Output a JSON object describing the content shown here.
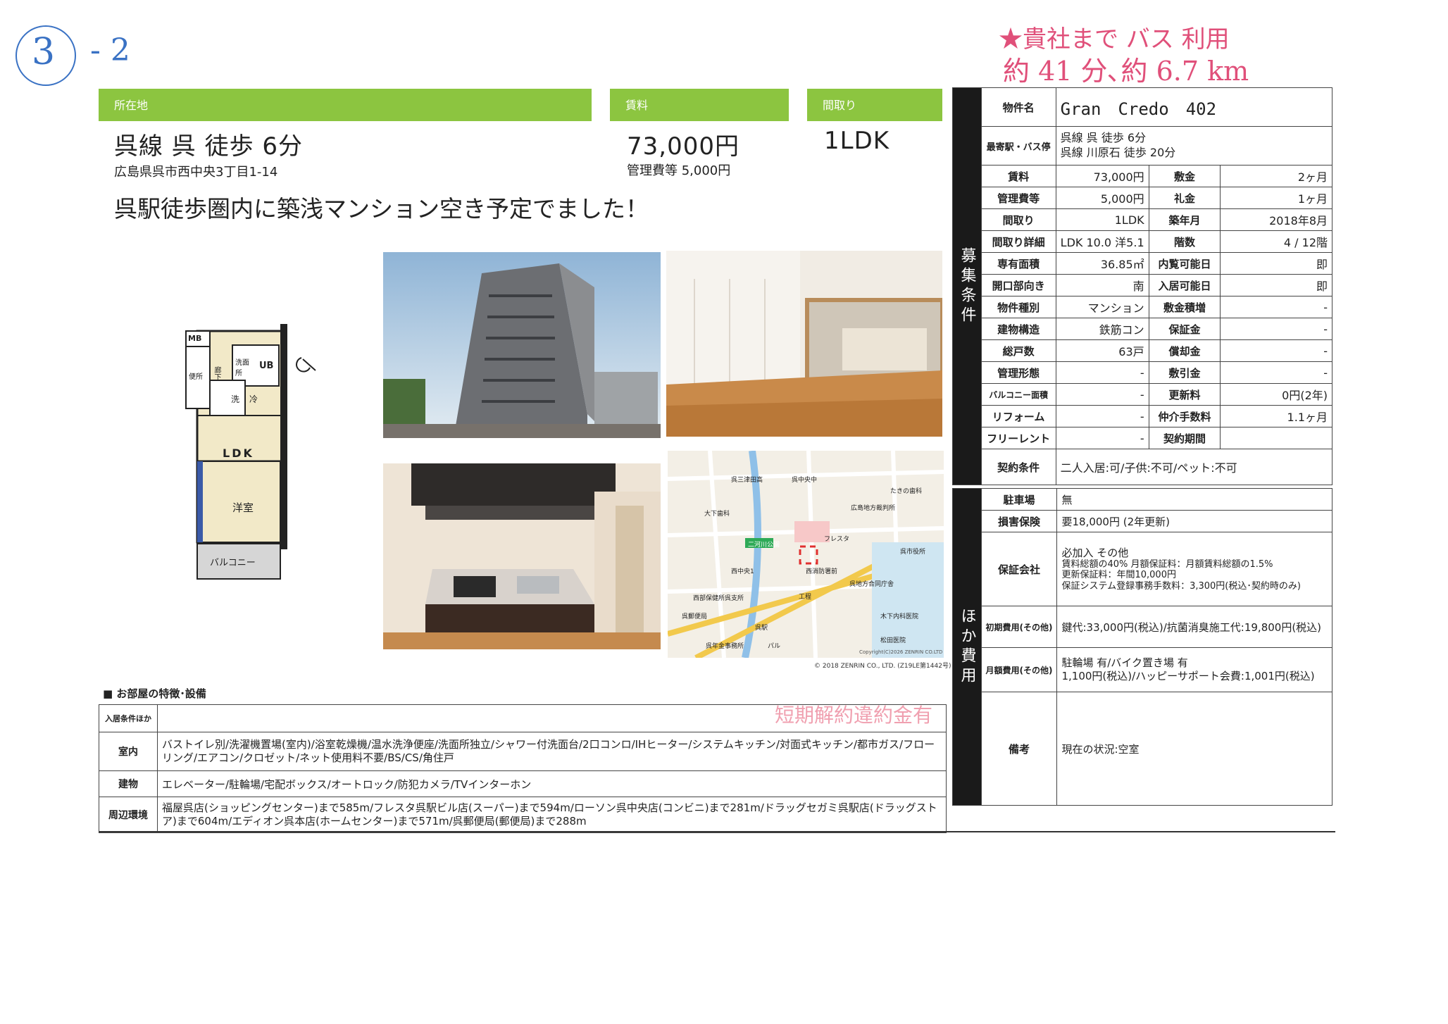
{
  "handwritten": {
    "circle_number": "3",
    "suffix": "- 2",
    "note_line1": "★貴社まで バス 利用",
    "note_line2": "約 41 分､約 6.7 km"
  },
  "header": {
    "location_label": "所在地",
    "rent_label": "賃料",
    "layout_label": "間取り"
  },
  "summary": {
    "station": "呉線 呉 徒歩 6分",
    "address": "広島県呉市西中央3丁目1-14",
    "rent": "73,000円",
    "management_fee": "管理費等 5,000円",
    "layout": "1LDK",
    "headline": "呉駅徒歩圏内に築浅マンション空き予定でました！"
  },
  "floorplan": {
    "mb": "MB",
    "toilet": "便所",
    "corridor": "廊下",
    "washroom": "洗面所",
    "ub": "UB",
    "wash": "洗",
    "fridge": "冷",
    "ldk": "LDK",
    "western_room": "洋室",
    "balcony": "バルコニー"
  },
  "map": {
    "labels": [
      "呉三津田高",
      "呉中央中",
      "たきの歯科",
      "大下歯科",
      "広島地方裁判所",
      "二河川公園",
      "フレスタ",
      "呉市役所",
      "西中央1",
      "西消防署前",
      "呉地方合同庁舎",
      "西部保健所呉支所",
      "工程",
      "木下内科医院",
      "呉郵便局",
      "呉年金事務所",
      "松田医院",
      "パル",
      "呉駅"
    ],
    "copyright1": "Copyright(C)2026 ZENRIN CO.LTD",
    "copyright2": "© 2018 ZENRIN CO., LTD. (Z19LE第1442号)"
  },
  "spec": {
    "band_recruit": "募集条件",
    "band_other": "ほか費用",
    "property_name_label": "物件名",
    "property_name": "Gran　Credo　402",
    "nearest_label": "最寄駅・バス停",
    "nearest1": "呉線 呉 徒歩 6分",
    "nearest2": "呉線 川原石 徒歩 20分",
    "rows": [
      {
        "l1": "賃料",
        "v1": "73,000円",
        "l2": "敷金",
        "v2": "2ヶ月"
      },
      {
        "l1": "管理費等",
        "v1": "5,000円",
        "l2": "礼金",
        "v2": "1ヶ月"
      },
      {
        "l1": "間取り",
        "v1": "1LDK",
        "l2": "築年月",
        "v2": "2018年8月"
      },
      {
        "l1": "間取り詳細",
        "v1": "LDK 10.0 洋5.1",
        "l2": "階数",
        "v2": "4 / 12階"
      },
      {
        "l1": "専有面積",
        "v1": "36.85㎡",
        "l2": "内覧可能日",
        "v2": "即"
      },
      {
        "l1": "開口部向き",
        "v1": "南",
        "l2": "入居可能日",
        "v2": "即"
      },
      {
        "l1": "物件種別",
        "v1": "マンション",
        "l2": "敷金積増",
        "v2": "-"
      },
      {
        "l1": "建物構造",
        "v1": "鉄筋コン",
        "l2": "保証金",
        "v2": "-"
      },
      {
        "l1": "総戸数",
        "v1": "63戸",
        "l2": "償却金",
        "v2": "-"
      },
      {
        "l1": "管理形態",
        "v1": "-",
        "l2": "敷引金",
        "v2": "-"
      },
      {
        "l1": "バルコニー面積",
        "v1": "-",
        "l2": "更新料",
        "v2": "0円(2年)"
      },
      {
        "l1": "リフォーム",
        "v1": "-",
        "l2": "仲介手数料",
        "v2": "1.1ヶ月"
      },
      {
        "l1": "フリーレント",
        "v1": "-",
        "l2": "契約期間",
        "v2": ""
      }
    ],
    "contract_label": "契約条件",
    "contract": "二人入居:可/子供:不可/ペット:不可",
    "parking_label": "駐車場",
    "parking": "無",
    "insurance_label": "損害保険",
    "insurance": "要18,000円 (2年更新)",
    "guarantor_label": "保証会社",
    "guarantor1": "必加入 その他",
    "guarantor2": "賃料総額の40% 月額保証料：月額賃料総額の1.5%",
    "guarantor3": "更新保証料：年間10,000円",
    "guarantor4": "保証システム登録事務手数料：3,300円(税込･契約時のみ)",
    "initial_label": "初期費用(その他)",
    "initial": "鍵代:33,000円(税込)/抗菌消臭施工代:19,800円(税込)",
    "monthly_label": "月額費用(その他)",
    "monthly1": "駐輪場 有/バイク置き場 有",
    "monthly2": "1,100円(税込)/ハッピーサポート会費:1,001円(税込)",
    "remarks_label": "備考",
    "remarks": "現在の状況:空室"
  },
  "features": {
    "title": "■ お部屋の特徴･設備",
    "stamp": "短期解約違約金有",
    "rows": [
      {
        "label": "入居条件ほか",
        "text": ""
      },
      {
        "label": "室内",
        "text": "バストイレ別/洗濯機置場(室内)/浴室乾燥機/温水洗浄便座/洗面所独立/シャワー付洗面台/2口コンロ/IHヒーター/システムキッチン/対面式キッチン/都市ガス/フローリング/エアコン/クロゼット/ネット使用料不要/BS/CS/角住戸"
      },
      {
        "label": "建物",
        "text": "エレベーター/駐輪場/宅配ボックス/オートロック/防犯カメラ/TVインターホン"
      },
      {
        "label": "周辺環境",
        "text": "福屋呉店(ショッピングセンター)まで585m/フレスタ呉駅ビル店(スーパー)まで594m/ローソン呉中央店(コンビニ)まで281m/ドラッグセガミ呉駅店(ドラッグストア)まで604m/エディオン呉本店(ホームセンター)まで571m/呉郵便局(郵便局)まで288m"
      }
    ]
  }
}
